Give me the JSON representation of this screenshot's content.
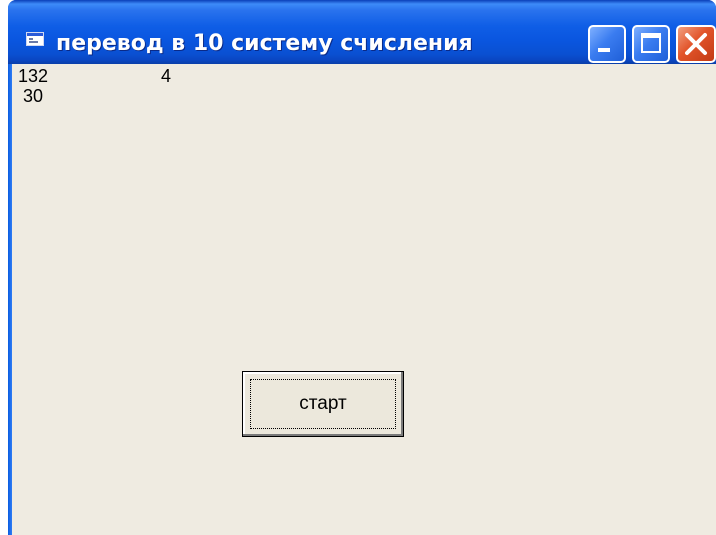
{
  "window": {
    "title": "перевод в 10 систему счисления",
    "title_icon": "form-icon",
    "titlebar_buttons": [
      "minimize-icon",
      "maximize-icon",
      "close-icon"
    ],
    "accent_color": "#0a56e0",
    "close_color": "#e2542a"
  },
  "output": {
    "line1_value": "132",
    "line1_base": "4",
    "line2_value": "30"
  },
  "start_button": {
    "label": "старт"
  }
}
